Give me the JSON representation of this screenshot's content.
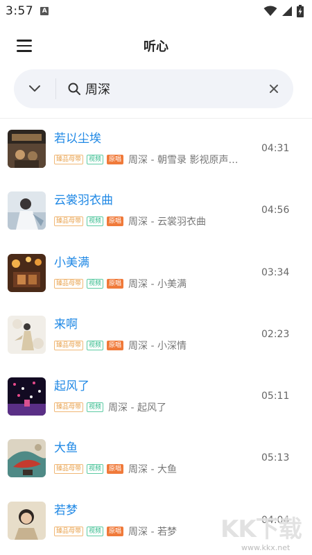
{
  "status_bar": {
    "time": "3:57",
    "notification_letter": "A"
  },
  "header": {
    "title": "听心"
  },
  "search": {
    "value": "周深",
    "placeholder": ""
  },
  "songs": [
    {
      "title": "若以尘埃",
      "tags": [
        "臻品母带",
        "视频",
        "原唱"
      ],
      "artist": "周深 - 朝雪录 影视原声…",
      "duration": "04:31"
    },
    {
      "title": "云裳羽衣曲",
      "tags": [
        "臻品母带",
        "视频",
        "原唱"
      ],
      "artist": "周深 - 云裳羽衣曲",
      "duration": "04:56"
    },
    {
      "title": "小美满",
      "tags": [
        "臻品母带",
        "视频",
        "原唱"
      ],
      "artist": "周深 - 小美满",
      "duration": "03:34"
    },
    {
      "title": "来啊",
      "tags": [
        "臻品母带",
        "视频",
        "原唱"
      ],
      "artist": "周深 - 小深情",
      "duration": "02:23"
    },
    {
      "title": "起风了",
      "tags": [
        "臻品母带",
        "视频"
      ],
      "artist": "周深 - 起风了",
      "duration": "05:11"
    },
    {
      "title": "大鱼",
      "tags": [
        "臻品母带",
        "视频",
        "原唱"
      ],
      "artist": "周深 - 大鱼",
      "duration": "05:13"
    },
    {
      "title": "若梦",
      "tags": [
        "臻品母带",
        "视频",
        "原唱"
      ],
      "artist": "周深 - 若梦",
      "duration": "04:04"
    }
  ],
  "watermark": {
    "logo": "KK下载",
    "url": "www.kkx.net"
  },
  "colors": {
    "title_blue": "#1f88e5",
    "tag_master": "#e8a14c",
    "tag_video": "#2fb98a",
    "tag_original": "#f07a3a",
    "search_bg": "#f1f3f8"
  },
  "icons": {
    "menu": "hamburger-icon",
    "chevron": "chevron-down-icon",
    "search": "search-icon",
    "clear": "close-icon",
    "wifi": "wifi-icon",
    "signal": "cell-signal-icon",
    "battery": "battery-charging-icon"
  }
}
